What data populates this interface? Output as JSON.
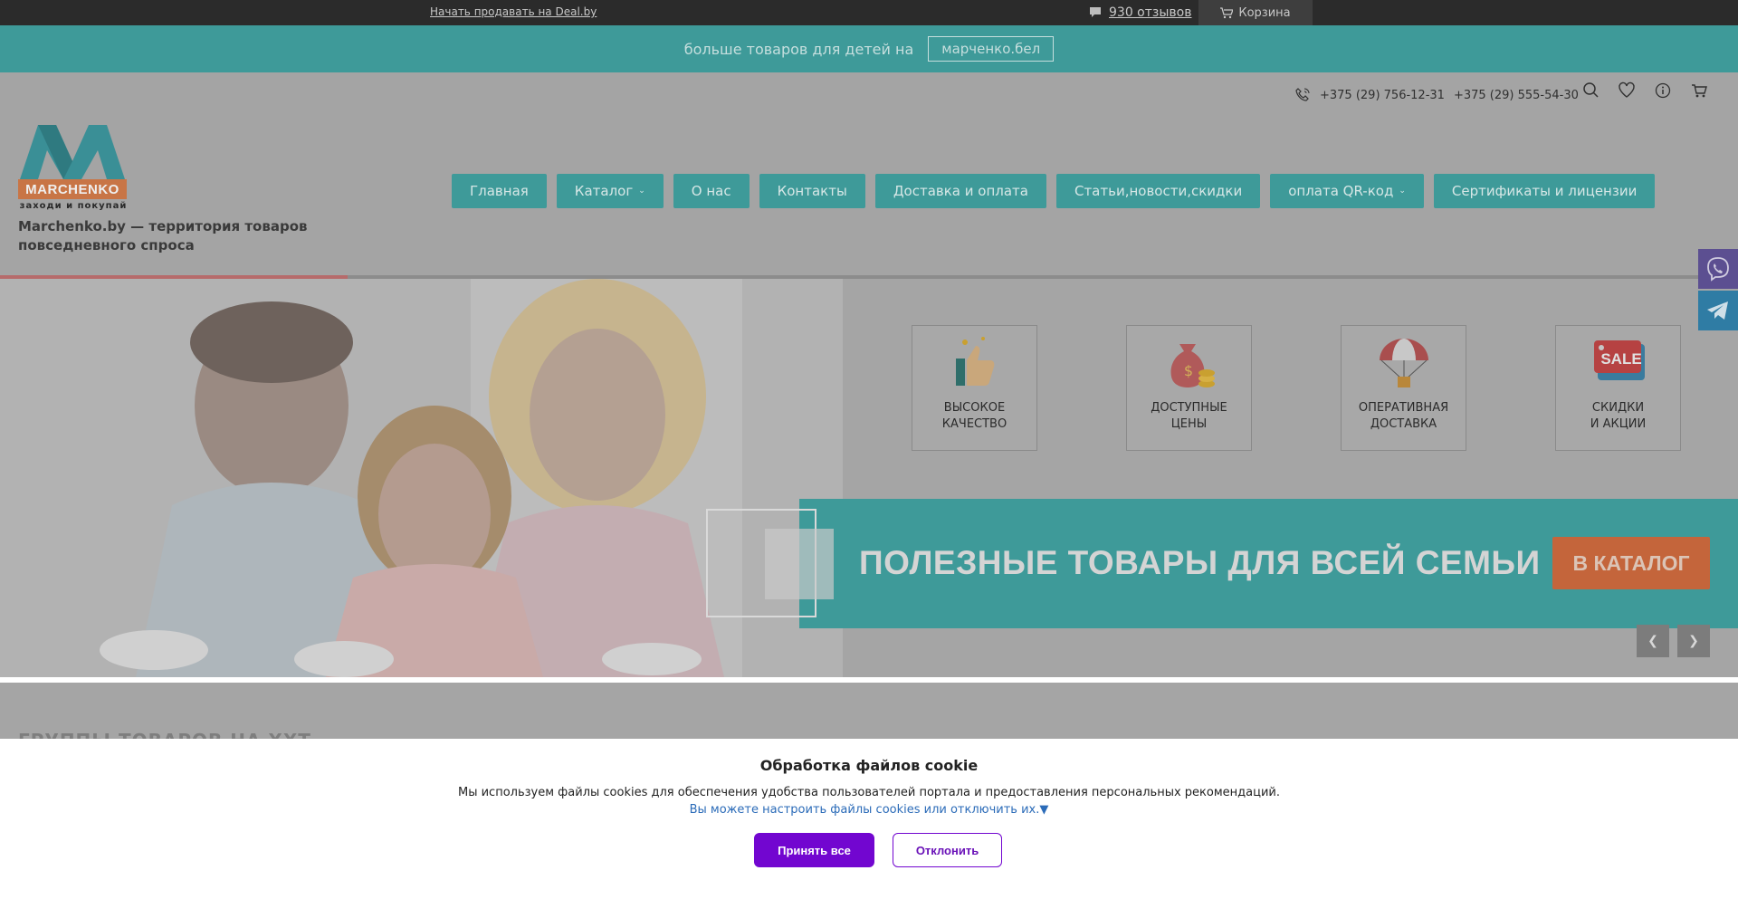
{
  "topbar": {
    "sell_link": "Начать продавать на Deal.by",
    "reviews": "930 отзывов",
    "cart": "Корзина"
  },
  "promo": {
    "text": "больше товаров для детей на",
    "button": "марченко.бел"
  },
  "header": {
    "phones": [
      "+375 (29) 756-12-31",
      "+375 (29) 555-54-30"
    ],
    "logo_word": "MARCHENKO",
    "logo_tagline": "заходи и покупай",
    "tagline": "Marchenko.by — территория товаров повседневного спроса",
    "tools": [
      "search-icon",
      "heart-icon",
      "info-icon",
      "cart-icon"
    ]
  },
  "nav": [
    {
      "label": "Главная",
      "dropdown": false
    },
    {
      "label": "Каталог",
      "dropdown": true
    },
    {
      "label": "О нас",
      "dropdown": false
    },
    {
      "label": "Контакты",
      "dropdown": false
    },
    {
      "label": "Доставка и оплата",
      "dropdown": false
    },
    {
      "label": "Статьи,новости,скидки",
      "dropdown": false
    },
    {
      "label": "оплата QR-код",
      "dropdown": true
    },
    {
      "label": "Сертификаты и лицензии",
      "dropdown": false
    }
  ],
  "features": [
    {
      "label": "ВЫСОКОЕ\nКАЧЕСТВО",
      "icon": "thumbs-up-icon"
    },
    {
      "label": "ДОСТУПНЫЕ\nЦЕНЫ",
      "icon": "money-bag-icon"
    },
    {
      "label": "ОПЕРАТИВНАЯ\nДОСТАВКА",
      "icon": "parachute-icon"
    },
    {
      "label": "СКИДКИ\nИ АКЦИИ",
      "icon": "sale-tag-icon"
    }
  ],
  "feature_sale_text": "SALE",
  "banner": {
    "title": "ПОЛЕЗНЫЕ ТОВАРЫ ДЛЯ ВСЕЙ СЕМЬИ",
    "button": "В КАТАЛОГ"
  },
  "section_heading": "ГРУППЫ ТОВАРОВ НА ХХТ",
  "cookie": {
    "title": "Обработка файлов cookie",
    "text": "Мы используем файлы cookies для обеспечения удобства пользователей портала и предоставления персональных рекомендаций.",
    "link": "Вы можете настроить файлы cookies или отключить их.▼",
    "accept": "Принять все",
    "decline": "Отклонить"
  },
  "colors": {
    "teal": "#3e9a99",
    "orange": "#c4653b",
    "purple": "#7206d0",
    "dark_bar": "#2b2b2b"
  }
}
